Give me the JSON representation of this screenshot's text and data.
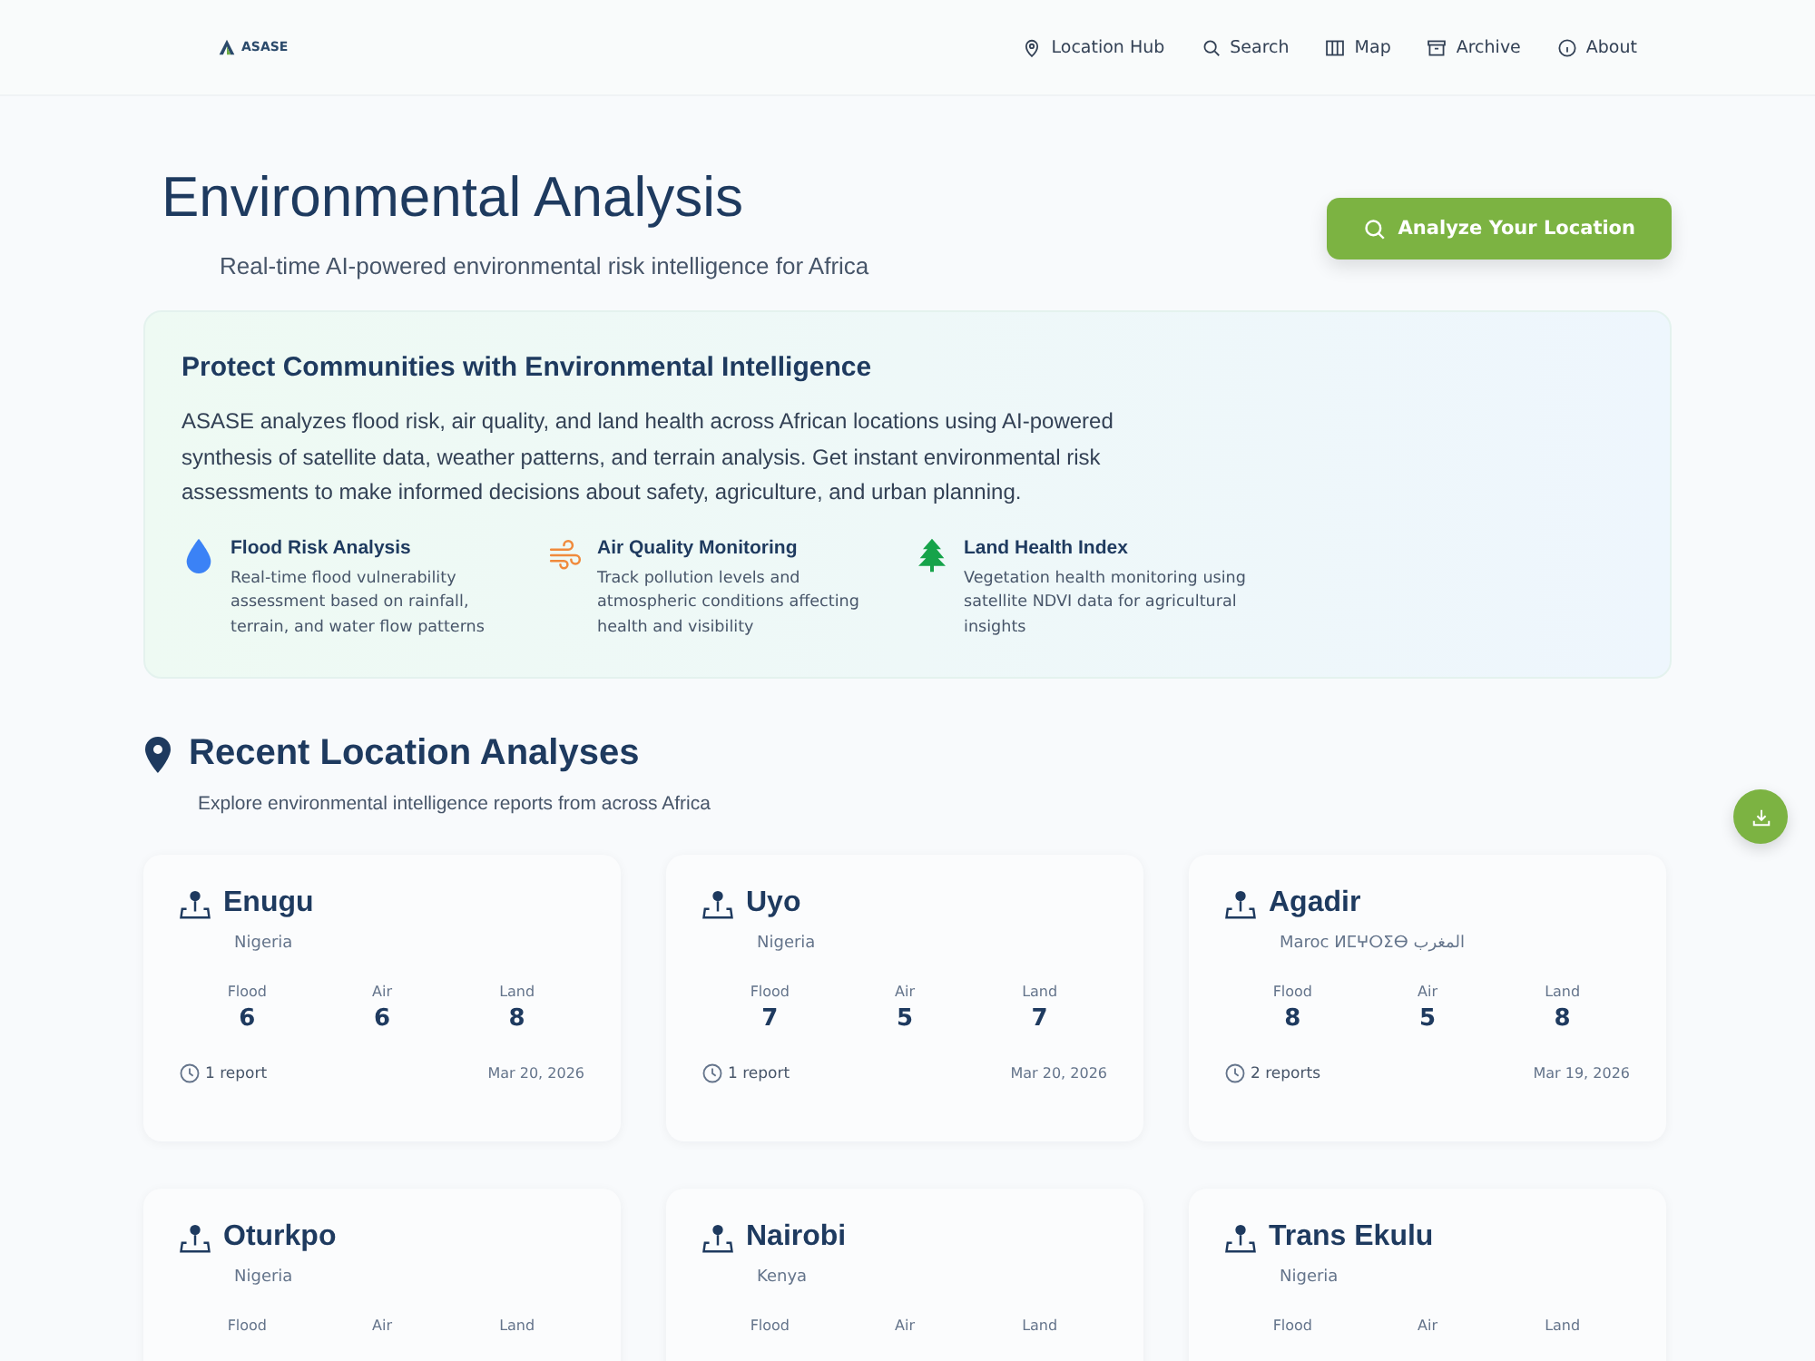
{
  "logo": {
    "text": "ASASE"
  },
  "nav": [
    {
      "label": "Location Hub"
    },
    {
      "label": "Search"
    },
    {
      "label": "Map"
    },
    {
      "label": "Archive"
    },
    {
      "label": "About"
    }
  ],
  "header": {
    "title": "Environmental Analysis",
    "subtitle": "Real-time AI-powered environmental risk intelligence for Africa",
    "button": "Analyze Your Location"
  },
  "intro": {
    "title": "Protect Communities with Environmental Intelligence",
    "text": "ASASE analyzes flood risk, air quality, and land health across African locations using AI-powered synthesis of satellite data, weather patterns, and terrain analysis. Get instant environmental risk assessments to make informed decisions about safety, agriculture, and urban planning.",
    "features": [
      {
        "kind": "drop",
        "title": "Flood Risk Analysis",
        "text": "Real-time flood vulnerability assessment based on rainfall, terrain, and water flow patterns"
      },
      {
        "kind": "wind",
        "title": "Air Quality Monitoring",
        "text": "Track pollution levels and atmospheric conditions affecting health and visibility"
      },
      {
        "kind": "tree",
        "title": "Land Health Index",
        "text": "Vegetation health monitoring using satellite NDVI data for agricultural insights"
      }
    ]
  },
  "recent": {
    "title": "Recent Location Analyses",
    "subtitle": "Explore environmental intelligence reports from across Africa",
    "cards": [
      {
        "name": "Enugu",
        "country": "Nigeria",
        "stats": [
          {
            "label": "Flood",
            "value": "6"
          },
          {
            "label": "Air",
            "value": "6"
          },
          {
            "label": "Land",
            "value": "8"
          }
        ],
        "reports": "1 report",
        "date": "Mar 20, 2026"
      },
      {
        "name": "Uyo",
        "country": "Nigeria",
        "stats": [
          {
            "label": "Flood",
            "value": "7"
          },
          {
            "label": "Air",
            "value": "5"
          },
          {
            "label": "Land",
            "value": "7"
          }
        ],
        "reports": "1 report",
        "date": "Mar 20, 2026"
      },
      {
        "name": "Agadir",
        "country": "Maroc ⵍⵎⵖⵔⵉⴱ المغرب",
        "stats": [
          {
            "label": "Flood",
            "value": "8"
          },
          {
            "label": "Air",
            "value": "5"
          },
          {
            "label": "Land",
            "value": "8"
          }
        ],
        "reports": "2 reports",
        "date": "Mar 19, 2026"
      },
      {
        "name": "Oturkpo",
        "country": "Nigeria",
        "stats": [
          {
            "label": "Flood"
          },
          {
            "label": "Air"
          },
          {
            "label": "Land"
          }
        ]
      },
      {
        "name": "Nairobi",
        "country": "Kenya",
        "stats": [
          {
            "label": "Flood"
          },
          {
            "label": "Air"
          },
          {
            "label": "Land"
          }
        ]
      },
      {
        "name": "Trans Ekulu",
        "country": "Nigeria",
        "stats": [
          {
            "label": "Flood"
          },
          {
            "label": "Air"
          },
          {
            "label": "Land"
          }
        ]
      }
    ]
  }
}
